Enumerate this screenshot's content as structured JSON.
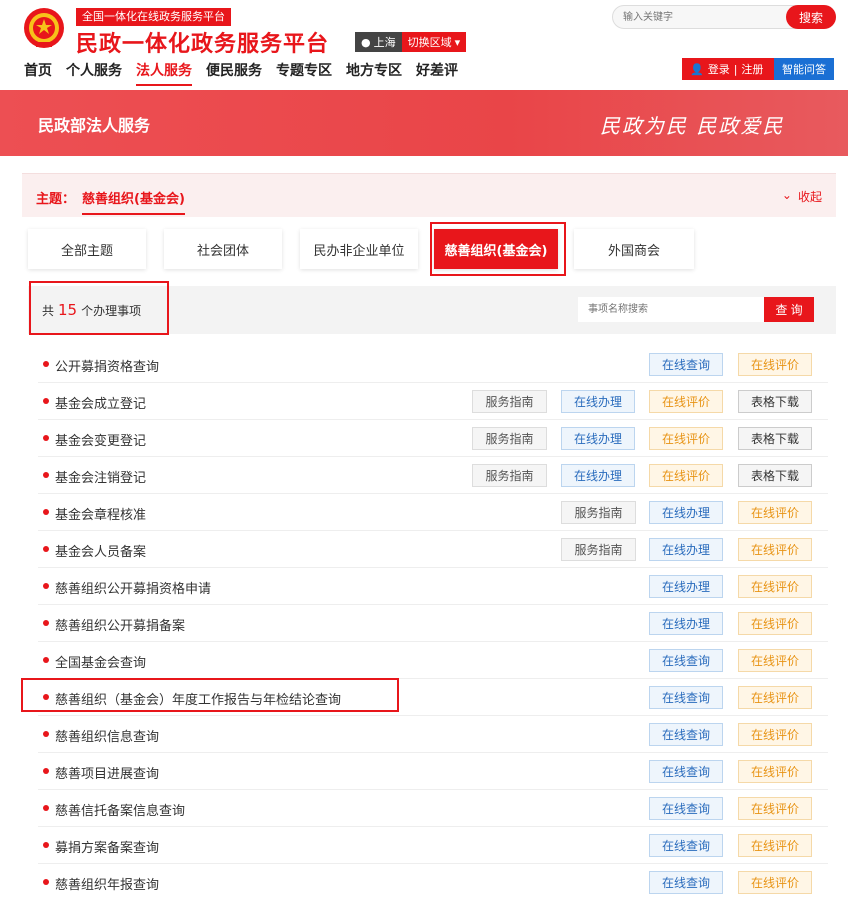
{
  "header": {
    "slogan": "全国一体化在线政务服务平台",
    "site_title": "民政一体化政务服务平台",
    "city": "上海",
    "switch_region": "切换区域",
    "search_placeholder": "输入关键字",
    "search_button": "搜索",
    "nav": [
      "首页",
      "个人服务",
      "法人服务",
      "便民服务",
      "专题专区",
      "地方专区",
      "好差评"
    ],
    "nav_active_index": 2,
    "login": "登录",
    "divider": "|",
    "register": "注册",
    "ai_qa": "智能问答"
  },
  "banner": {
    "title": "民政部法人服务",
    "slogan": "民政为民  民政爱民"
  },
  "topic": {
    "label": "主题：",
    "value": "慈善组织(基金会)",
    "collapse": "收起"
  },
  "tabs": [
    "全部主题",
    "社会团体",
    "民办非企业单位",
    "慈善组织(基金会)",
    "外国商会"
  ],
  "tabs_active_index": 3,
  "filter": {
    "count_prefix": "共",
    "count": "15",
    "count_suffix": "个办理事项",
    "search_placeholder": "事项名称搜索",
    "search_button": "查 询"
  },
  "items": [
    {
      "title": "公开募捐资格查询",
      "actions": [
        "在线查询",
        "在线评价"
      ]
    },
    {
      "title": "基金会成立登记",
      "actions": [
        "服务指南",
        "在线办理",
        "在线评价",
        "表格下载"
      ]
    },
    {
      "title": "基金会变更登记",
      "actions": [
        "服务指南",
        "在线办理",
        "在线评价",
        "表格下载"
      ]
    },
    {
      "title": "基金会注销登记",
      "actions": [
        "服务指南",
        "在线办理",
        "在线评价",
        "表格下载"
      ]
    },
    {
      "title": "基金会章程核准",
      "actions": [
        "服务指南",
        "在线办理",
        "在线评价"
      ]
    },
    {
      "title": "基金会人员备案",
      "actions": [
        "服务指南",
        "在线办理",
        "在线评价"
      ]
    },
    {
      "title": "慈善组织公开募捐资格申请",
      "actions": [
        "在线办理",
        "在线评价"
      ]
    },
    {
      "title": "慈善组织公开募捐备案",
      "actions": [
        "在线办理",
        "在线评价"
      ]
    },
    {
      "title": "全国基金会查询",
      "actions": [
        "在线查询",
        "在线评价"
      ]
    },
    {
      "title": "慈善组织（基金会）年度工作报告与年检结论查询",
      "actions": [
        "在线查询",
        "在线评价"
      ]
    },
    {
      "title": "慈善组织信息查询",
      "actions": [
        "在线查询",
        "在线评价"
      ]
    },
    {
      "title": "慈善项目进展查询",
      "actions": [
        "在线查询",
        "在线评价"
      ]
    },
    {
      "title": "慈善信托备案信息查询",
      "actions": [
        "在线查询",
        "在线评价"
      ]
    },
    {
      "title": "募捐方案备案查询",
      "actions": [
        "在线查询",
        "在线评价"
      ]
    },
    {
      "title": "慈善组织年报查询",
      "actions": [
        "在线查询",
        "在线评价"
      ]
    }
  ],
  "colors": {
    "brand_red": "#e8161b",
    "online_blue": "#2a6cbd",
    "rate_orange": "#e89416"
  }
}
